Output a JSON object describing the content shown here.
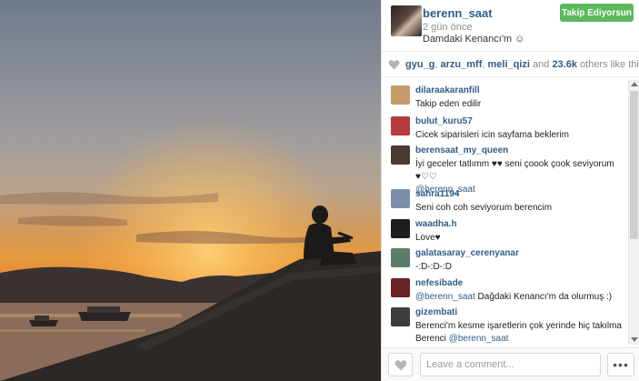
{
  "post": {
    "username": "berenn_saat",
    "time_ago": "2 gün önce",
    "caption": "Damdaki Kenancı'm ☺",
    "follow_label": "Takip Ediyorsun"
  },
  "likes": {
    "users": [
      "gyu_g",
      "arzu_mff",
      "meli_qizi"
    ],
    "separator": ", ",
    "and_text": " and ",
    "count": "23.6k",
    "suffix": " others like this."
  },
  "comments": [
    {
      "user": "dilaraakaranfill",
      "text": "Takip eden edilir",
      "avatar_color": "#c79a6a"
    },
    {
      "user": "bulut_kuru57",
      "text": "Cicek siparisleri icin sayfama beklerim",
      "avatar_color": "#b83a3a"
    },
    {
      "user": "berensaat_my_queen",
      "text": "İyi geceler tatlımm ♥♥ seni çoook çook seviyorum ♥♡♡",
      "mention": "@berenn_saat",
      "avatar_color": "#4a3a32"
    },
    {
      "user": "sahra1194",
      "text": "Seni coh coh seviyorum berencim",
      "avatar_color": "#7b8fa8"
    },
    {
      "user": "waadha.h",
      "text": "Love♥",
      "avatar_color": "#1e1e1e"
    },
    {
      "user": "galatasaray_cerenyanar",
      "text": "-:D-:D-:D",
      "avatar_color": "#5c7d6a"
    },
    {
      "user": "nefesibade",
      "mention": "@berenn_saat",
      "text": " Dağdaki Kenancı'm da olurmuş :)",
      "avatar_color": "#6a2222"
    },
    {
      "user": "gizembati",
      "text": "Berenci'm kesme işaretlerin çok yerinde hiç takılma Berenci ",
      "mention": "@berenn_saat",
      "avatar_color": "#3d3d3d"
    }
  ],
  "comment_box": {
    "placeholder": "Leave a comment...",
    "more_label": "•••"
  },
  "colors": {
    "link": "#2f5d87",
    "follow_button": "#5cb85c",
    "muted": "#8a8a8a"
  },
  "icons": {
    "like": "heart-icon",
    "more": "ellipsis-icon"
  }
}
